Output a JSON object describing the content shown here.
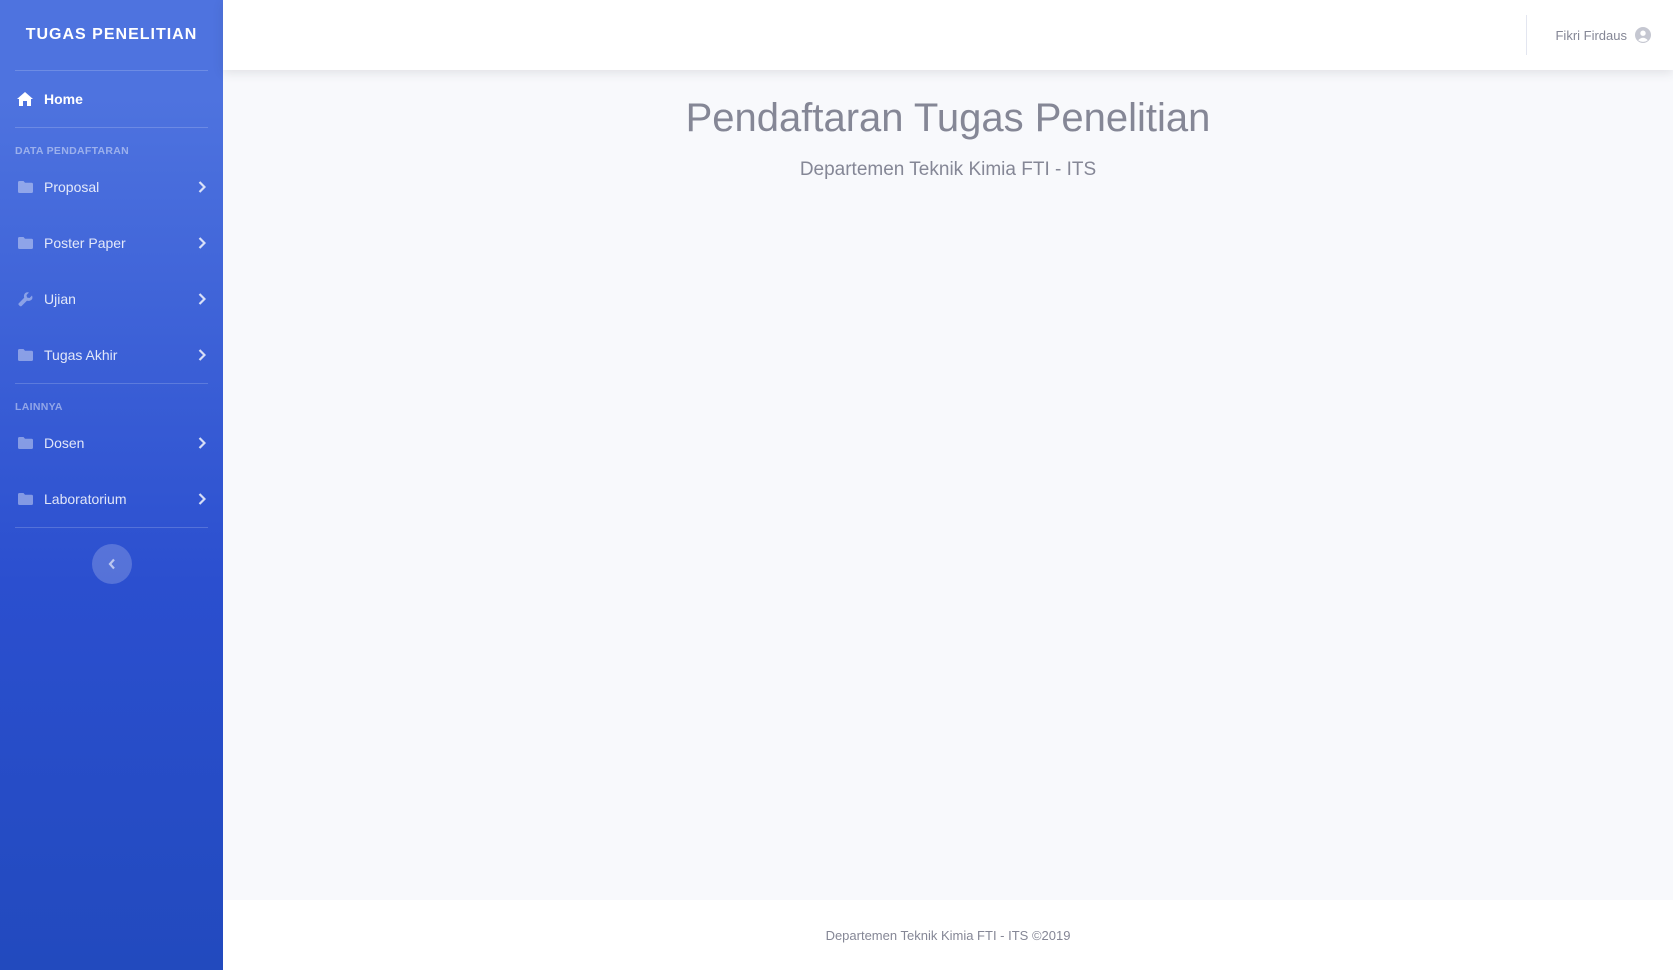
{
  "sidebar": {
    "brand": "TUGAS PENELITIAN",
    "home": {
      "label": "Home",
      "icon": "home-icon"
    },
    "section1_heading": "DATA PENDAFTARAN",
    "section1_items": [
      {
        "label": "Proposal",
        "icon": "folder-icon"
      },
      {
        "label": "Poster Paper",
        "icon": "folder-icon"
      },
      {
        "label": "Ujian",
        "icon": "wrench-icon"
      },
      {
        "label": "Tugas Akhir",
        "icon": "folder-icon"
      }
    ],
    "section2_heading": "LAINNYA",
    "section2_items": [
      {
        "label": "Dosen",
        "icon": "folder-icon"
      },
      {
        "label": "Laboratorium",
        "icon": "folder-icon"
      }
    ],
    "toggle_icon": "chevron-left-icon"
  },
  "topbar": {
    "user_name": "Fikri Firdaus",
    "user_icon": "user-circle-icon"
  },
  "main": {
    "title": "Pendaftaran Tugas Penelitian",
    "subtitle": "Departemen Teknik Kimia FTI - ITS"
  },
  "footer": {
    "text": "Departemen Teknik Kimia FTI - ITS ©2019"
  },
  "colors": {
    "sidebar_top": "#4e73df",
    "sidebar_bottom": "#224abe",
    "text_gray": "#858796",
    "content_bg": "#f8f9fc"
  }
}
